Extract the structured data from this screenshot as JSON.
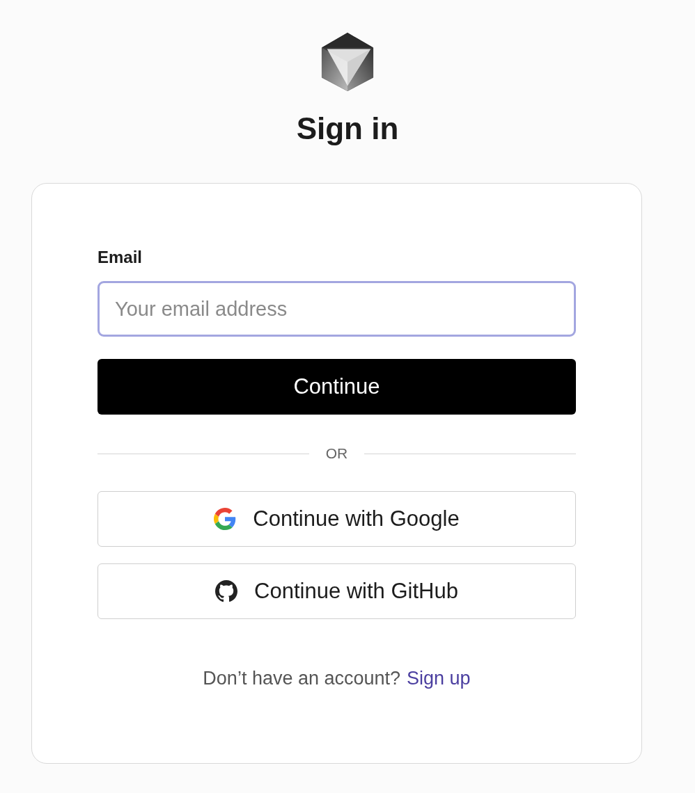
{
  "title": "Sign in",
  "form": {
    "email_label": "Email",
    "email_placeholder": "Your email address",
    "submit": "Continue",
    "divider": "OR"
  },
  "providers": [
    {
      "kind": "google",
      "label": "Continue with Google"
    },
    {
      "kind": "github",
      "label": "Continue with GitHub"
    }
  ],
  "footer": {
    "text": "Don’t have an account?",
    "link": "Sign up"
  }
}
